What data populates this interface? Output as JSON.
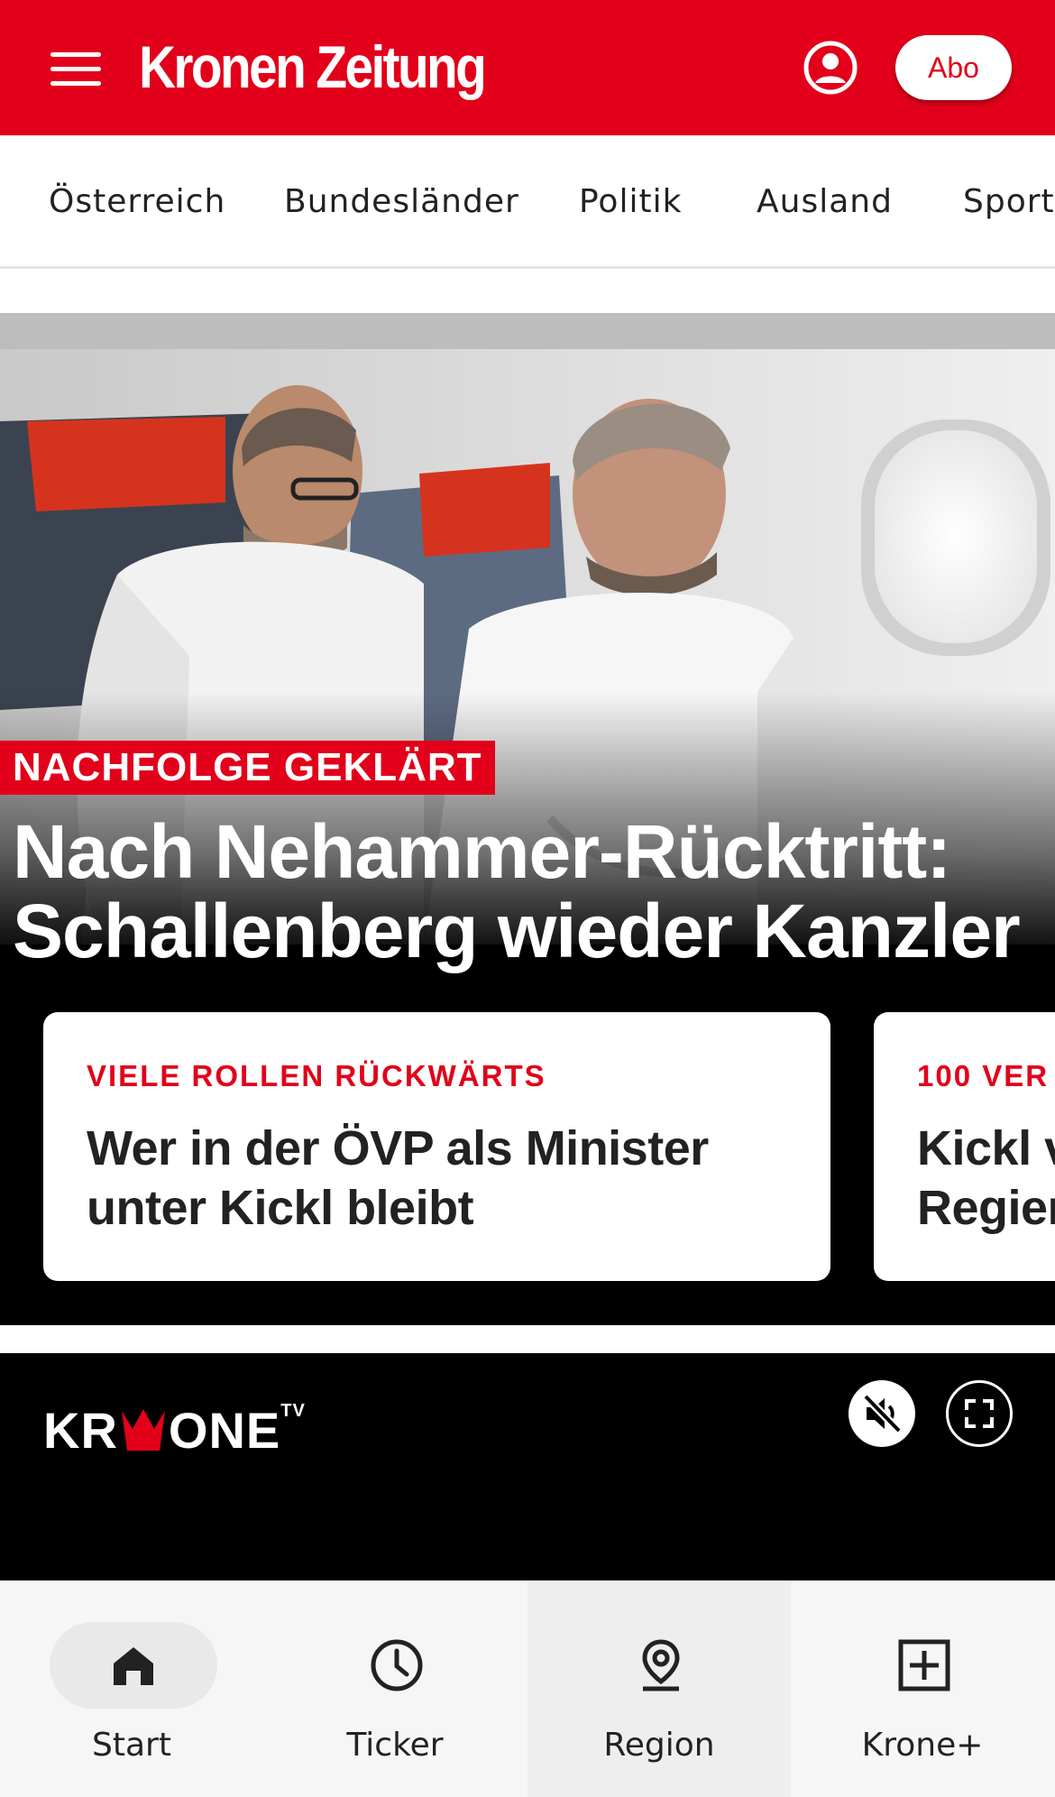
{
  "colors": {
    "brand_red": "#e2001a",
    "header_bg": "#e2001a",
    "hero_bg": "#000000",
    "bottom_nav_bg": "#f6f6f6"
  },
  "header": {
    "menu_icon": "hamburger-menu-icon",
    "logo_text": "Kronen Zeitung",
    "account_icon": "user-account-icon",
    "abo_label": "Abo"
  },
  "sections": [
    {
      "label": "Österreich"
    },
    {
      "label": "Bundesländer"
    },
    {
      "label": "Politik"
    },
    {
      "label": "Ausland"
    },
    {
      "label": "Sport"
    }
  ],
  "hero": {
    "kicker": "NACHFOLGE GEKLÄRT",
    "headline": "Nach Nehammer-Rücktritt: Schallenberg wieder Kanzler",
    "teasers": [
      {
        "kicker": "VIELE ROLLEN RÜCKWÄRTS",
        "title": "Wer in der ÖVP als Minister\nunter Kickl bleibt"
      },
      {
        "kicker": "100 VER",
        "title": "Kickl v\nRegier"
      }
    ]
  },
  "tv": {
    "logo_text_left": "KR",
    "logo_text_right": "ONE",
    "logo_sup": "TV",
    "mute_icon": "muted-speaker-icon",
    "fullscreen_icon": "fullscreen-icon"
  },
  "bottom_nav": [
    {
      "label": "Start",
      "icon": "home-icon"
    },
    {
      "label": "Ticker",
      "icon": "clock-icon"
    },
    {
      "label": "Region",
      "icon": "location-pin-icon"
    },
    {
      "label": "Krone+",
      "icon": "plus-square-icon"
    }
  ]
}
